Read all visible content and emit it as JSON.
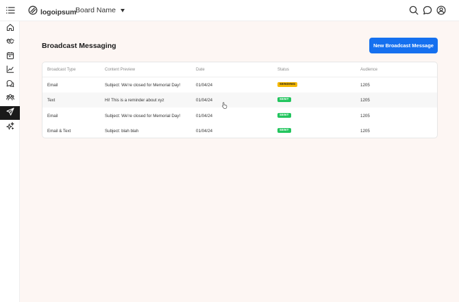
{
  "header": {
    "logo_text": "logoipsum",
    "board_name": "Board Name"
  },
  "icons": {
    "menu": "list-icon",
    "search": "search-icon",
    "chat": "chat-bubble-icon",
    "account": "user-circle-icon"
  },
  "sidebar": {
    "items": [
      {
        "icon": "home-icon"
      },
      {
        "icon": "handshake-icon"
      },
      {
        "icon": "calendar-icon"
      },
      {
        "icon": "chart-line-icon"
      },
      {
        "icon": "chat-bubbles-icon"
      },
      {
        "icon": "users-icon"
      },
      {
        "icon": "send-icon",
        "active": true
      },
      {
        "icon": "sparkles-icon"
      }
    ]
  },
  "page": {
    "title": "Broadcast Messaging",
    "new_button": "New Broadcast Message"
  },
  "table": {
    "columns": [
      "Broadcast Type",
      "Content Preview",
      "Date",
      "Status",
      "Audience"
    ],
    "rows": [
      {
        "type": "Email",
        "preview": "Subject: We're closed for Memorial Day!",
        "date": "01/04/24",
        "status": "SENDING",
        "audience": "1205"
      },
      {
        "type": "Text",
        "preview": "Hi! This is a reminder about xyz",
        "date": "01/04/24",
        "status": "SENT",
        "audience": "1205"
      },
      {
        "type": "Email",
        "preview": "Subject: We're closed for Memorial Day!",
        "date": "01/04/24",
        "status": "SENT",
        "audience": "1205"
      },
      {
        "type": "Email & Text",
        "preview": "Subject: blah blah",
        "date": "01/04/24",
        "status": "SENT",
        "audience": "1205"
      }
    ]
  },
  "colors": {
    "accent": "#1570ef",
    "sending": "#f5b800",
    "sent": "#22c55e",
    "sidebar_active": "#1a1a1a",
    "background": "#fdf6f3"
  }
}
